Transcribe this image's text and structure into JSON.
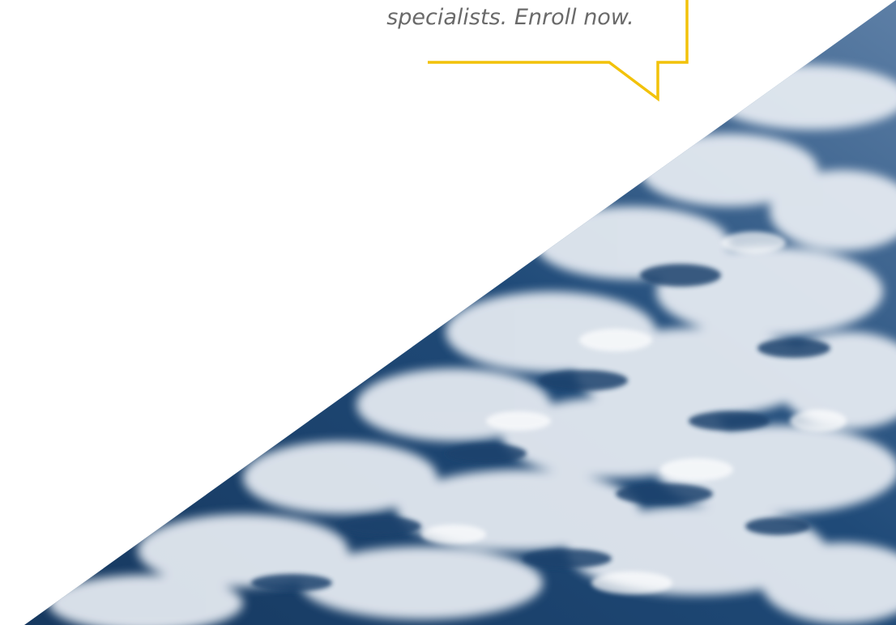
{
  "promo": {
    "callout_text": "specialists. Enroll now.",
    "border_color": "#f2c20a"
  },
  "hero_image": {
    "subject": "earth-clouds-photo"
  }
}
